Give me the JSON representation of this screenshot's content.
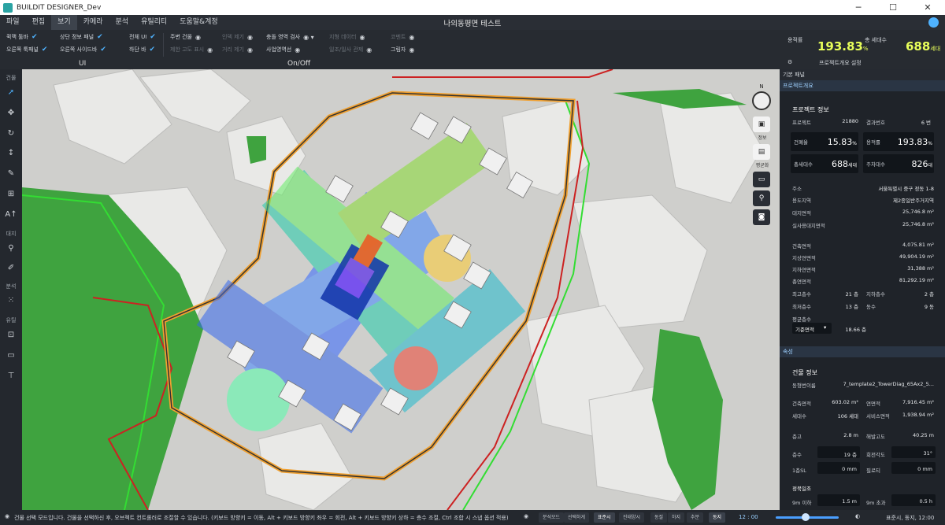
{
  "app": {
    "title": "BUILDIT DESIGNER_Dev",
    "document": "나의동평면 테스트"
  },
  "menu": [
    "파일",
    "편집",
    "보기",
    "카메라",
    "분석",
    "유틸리티",
    "도움말&계정"
  ],
  "ribbon": {
    "ui_items": [
      {
        "label": "퀵맥 툴바",
        "checked": true
      },
      {
        "label": "상단 정보 패널",
        "checked": true
      },
      {
        "label": "전체 UI",
        "checked": true
      },
      {
        "label": "오른쪽 툭패널",
        "checked": true
      },
      {
        "label": "오른쪽 사이드바",
        "checked": true
      },
      {
        "label": "하단 바",
        "checked": true
      }
    ],
    "view_items": [
      {
        "label": "주변 건물",
        "active": true
      },
      {
        "label": "인덱 제기",
        "active": false
      },
      {
        "label": "충돌 영역 검사",
        "active": true
      },
      {
        "label": "지형 데이터",
        "active": false
      },
      {
        "label": "코멘트",
        "active": false
      },
      {
        "label": "제한 고도 표시",
        "active": false
      },
      {
        "label": "거리 제기",
        "active": false
      },
      {
        "label": "사업영역선",
        "active": true
      },
      {
        "label": "일조/일사 관제",
        "active": false
      },
      {
        "label": "그림자",
        "active": true
      }
    ],
    "group_ui": "UI",
    "group_onoff": "On/Off"
  },
  "metrics": {
    "far_label": "용적률",
    "far_value": "193.83",
    "far_unit": "%",
    "units_label": "총 세대수",
    "units_value": "688",
    "units_unit": "세대",
    "settings_label": "프로젝트개요 설정"
  },
  "toolbar": {
    "sections": [
      "건물",
      "대지",
      "분석",
      "유틸"
    ],
    "icons": [
      "select-icon",
      "move-icon",
      "rotate-icon",
      "height-icon",
      "draw-icon",
      "add-icon",
      "text-icon",
      "site-icon",
      "brush-icon",
      "analysis-icon",
      "grid-icon",
      "measure-icon",
      "stamp-icon"
    ]
  },
  "viewport": {
    "north": "N",
    "tools": [
      {
        "icon": "camera-view-icon",
        "label": "정보"
      },
      {
        "icon": "save-icon",
        "label": "평균화"
      },
      {
        "icon": "screen-icon",
        "label": ""
      },
      {
        "icon": "location-icon",
        "label": ""
      },
      {
        "icon": "capture-icon",
        "label": ""
      }
    ]
  },
  "panel": {
    "basic_panel": "기본 패널",
    "project_tab": "프로젝트개요",
    "project_info": "프로젝트 정보",
    "project_label": "프로젝트",
    "project_value": "21880",
    "result_label": "결과번호",
    "result_value": "6 번",
    "bcr_label": "건폐율",
    "bcr_value": "15.83",
    "bcr_unit": "%",
    "far_label": "용적률",
    "far_value": "193.83",
    "far_unit": "%",
    "units_label": "총세대수",
    "units_value": "688",
    "units_unit": "세대",
    "parking_label": "주차대수",
    "parking_value": "826",
    "parking_unit": "대",
    "addr_label": "주소",
    "addr_value": "서울특별시 중구 정동 1-8",
    "zone_label": "용도지역",
    "zone_value": "제2종일반주거지역",
    "site_label": "대지면적",
    "site_value": "25,746.8 m²",
    "realsite_label": "실사용대지면적",
    "realsite_value": "25,746.8 m²",
    "building_area_label": "건축면적",
    "building_area_value": "4,075.81 m²",
    "above_label": "지상연면적",
    "above_value": "49,904.19 m²",
    "below_label": "지하연면적",
    "below_value": "31,388 m²",
    "total_label": "총연면적",
    "total_value": "81,292.19 m²",
    "maxf_label": "최고층수",
    "maxf_value": "21 층",
    "basement_label": "지하층수",
    "basement_value": "2 층",
    "minf_label": "최저층수",
    "minf_value": "13 층",
    "blocks_label": "동수",
    "blocks_value": "9 동",
    "avgf_label": "평균층수",
    "avgf_select": "기준면적",
    "avgf_value": "18.66 층",
    "attr_tab": "속성",
    "bldg_info": "건물 정보",
    "type_label": "동형번이름",
    "type_value": "7_template2_TowerDiag_65Ax2_5...",
    "ba_label": "건축면적",
    "ba_value": "603.02 m²",
    "ga_label": "연면적",
    "ga_value": "7,916.45 m²",
    "hh_label": "세대수",
    "hh_value": "106 세대",
    "svc_label": "서비스면적",
    "svc_value": "1,938.94 m²",
    "fh_label": "층고",
    "fh_value": "2.8 m",
    "elev_label": "해발고도",
    "elev_value": "40.25 m",
    "floors_label": "층수",
    "floors_value": "19 층",
    "rot_label": "회전각도",
    "rot_value": "31°",
    "first_label": "1층SL",
    "first_value": "0 mm",
    "pil_label": "필로티",
    "pil_value": "0 mm",
    "setback_label": "정북일조",
    "sb1_label": "9m 이하",
    "sb1_value": "1.5 m",
    "sb2_label": "9m 초과",
    "sb2_value": "0.5 h"
  },
  "status": {
    "message": "건물 선택 모드입니다. 건물을 선택하신 후, 오브젝트 컨트롤러로 조절할 수 있습니다. (키보드 방향키 = 이동, Alt + 키보드 방향키 좌우 = 회전, Alt + 키보드 방향키 상하 = 층수 조절, Ctrl 조합 시 스냅 옵션 적용)",
    "buttons": [
      "분석모드",
      "선택하게",
      "표준시",
      "진태양시",
      "동절",
      "하지",
      "추분",
      "동지"
    ],
    "time": "12 : 00",
    "date": "표준시, 동지, 12:00"
  }
}
